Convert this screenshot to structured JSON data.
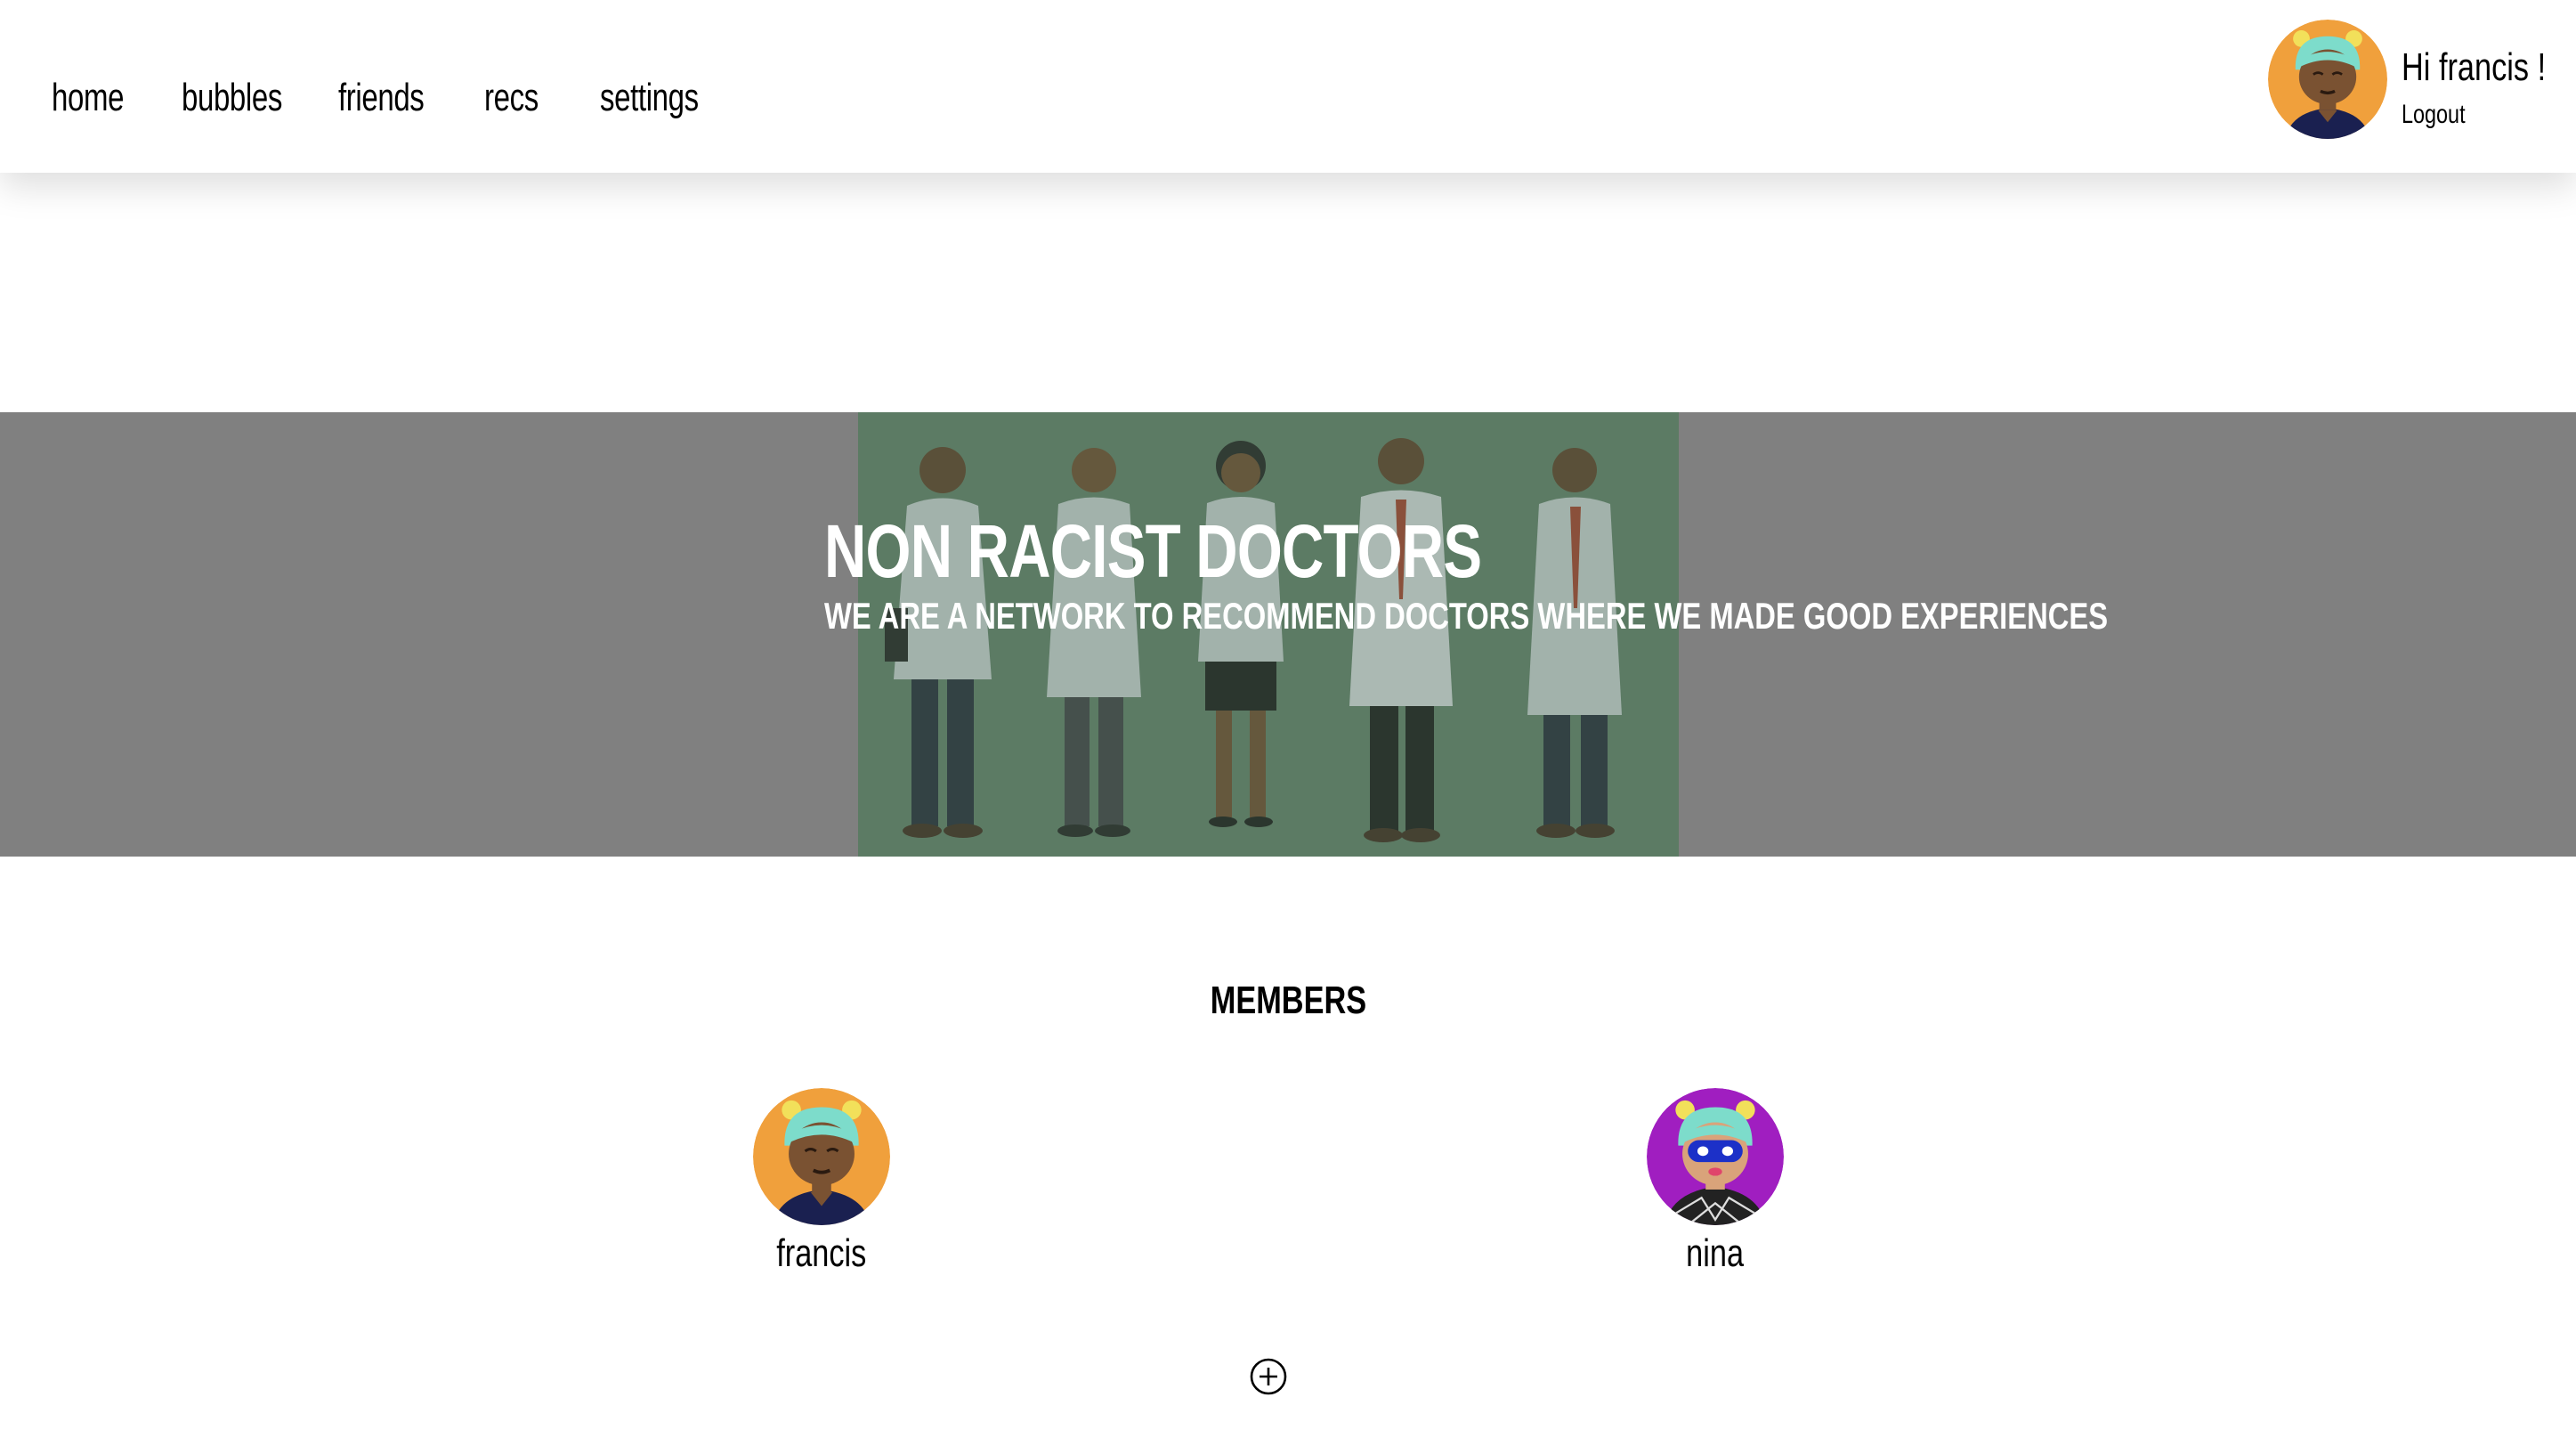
{
  "nav": {
    "items": [
      {
        "key": "home",
        "label": "home"
      },
      {
        "key": "bubbles",
        "label": "bubbles"
      },
      {
        "key": "friends",
        "label": "friends"
      },
      {
        "key": "recs",
        "label": "recs"
      },
      {
        "key": "settings",
        "label": "settings"
      }
    ]
  },
  "user": {
    "greeting": "Hi francis !",
    "logout_label": "Logout",
    "avatar_icon": "avatar-francis-icon"
  },
  "hero": {
    "title": "NON RACIST DOCTORS",
    "subtitle": "WE ARE A NETWORK TO RECOMMEND DOCTORS WHERE WE MADE GOOD EXPERIENCES",
    "image_icon": "doctors-illustration-icon"
  },
  "members": {
    "title": "MEMBERS",
    "list": [
      {
        "name": "francis",
        "avatar_color": "#f0a03c"
      },
      {
        "name": "nina",
        "avatar_color": "#a01ec0"
      }
    ],
    "add_icon": "plus-circle-icon"
  },
  "colors": {
    "hero_bg": "#808080",
    "hero_image_bg": "#5d7b65",
    "francis_avatar": "#f0a03c",
    "nina_avatar": "#a01ec0",
    "mask": "#7ddccb",
    "ears": "#f2e05a"
  }
}
